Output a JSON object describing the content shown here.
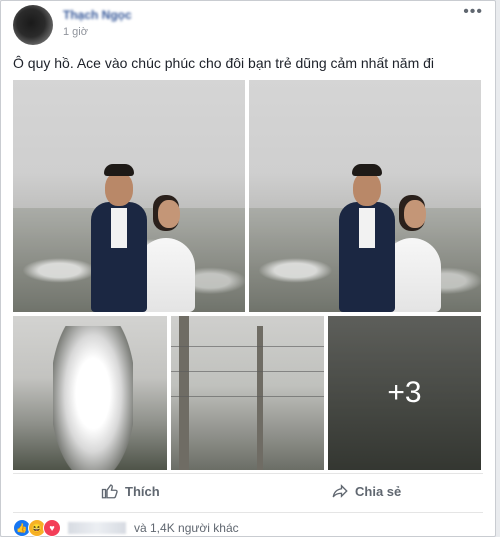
{
  "post": {
    "author": "Thạch Ngọc",
    "time": "1 giờ",
    "more": "•••",
    "caption": "Ô quy hồ. Ace vào chúc phúc cho đôi bạn trẻ dũng cảm nhất năm đi",
    "extra_photos": "+3"
  },
  "actions": {
    "like": "Thích",
    "share": "Chia sẻ"
  },
  "reactions": {
    "others": "và 1,4K người khác",
    "icons": [
      "like-icon",
      "haha-icon",
      "love-icon"
    ]
  }
}
